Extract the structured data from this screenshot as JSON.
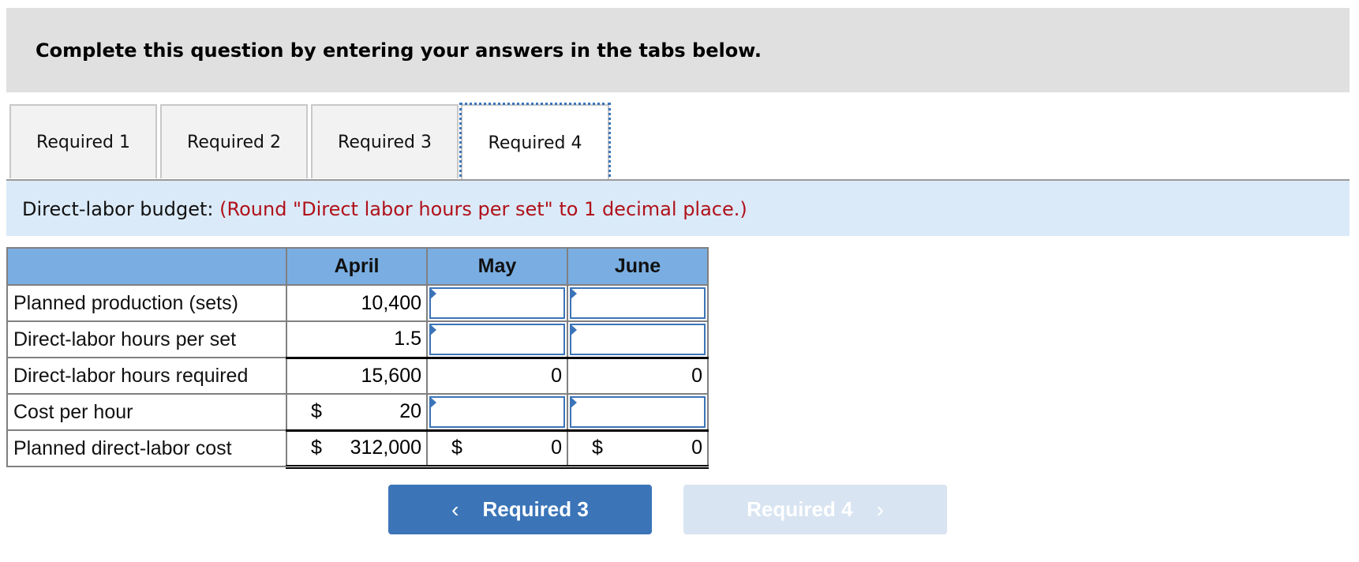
{
  "banner": {
    "title": "Complete this question by entering your answers in the tabs below."
  },
  "tabs": [
    {
      "label": "Required 1",
      "active": false
    },
    {
      "label": "Required 2",
      "active": false
    },
    {
      "label": "Required 3",
      "active": false
    },
    {
      "label": "Required 4",
      "active": true
    }
  ],
  "instruction": {
    "prefix": "Direct-labor budget:",
    "note": "(Round \"Direct labor hours per set\" to 1 decimal place.)"
  },
  "table": {
    "headers": [
      "",
      "April",
      "May",
      "June"
    ],
    "rows": [
      {
        "label": "Planned production (sets)",
        "april": "10,400",
        "may": "",
        "june": ""
      },
      {
        "label": "Direct-labor hours per set",
        "april": "1.5",
        "may": "",
        "june": ""
      },
      {
        "label": "Direct-labor hours required",
        "april": "15,600",
        "may": "0",
        "june": "0"
      },
      {
        "label": "Cost per hour",
        "april_currency": "$",
        "april": "20",
        "may": "",
        "june": ""
      },
      {
        "label": "Planned direct-labor cost",
        "april_currency": "$",
        "april": "312,000",
        "may_currency": "$",
        "may": "0",
        "june_currency": "$",
        "june": "0"
      }
    ]
  },
  "nav": {
    "prev_label": "Required 3",
    "next_label": "Required 4",
    "prev_icon": "chevron-left-icon",
    "next_icon": "chevron-right-icon",
    "prev_color": "#3b75b8",
    "next_color": "#d8e4f1"
  }
}
